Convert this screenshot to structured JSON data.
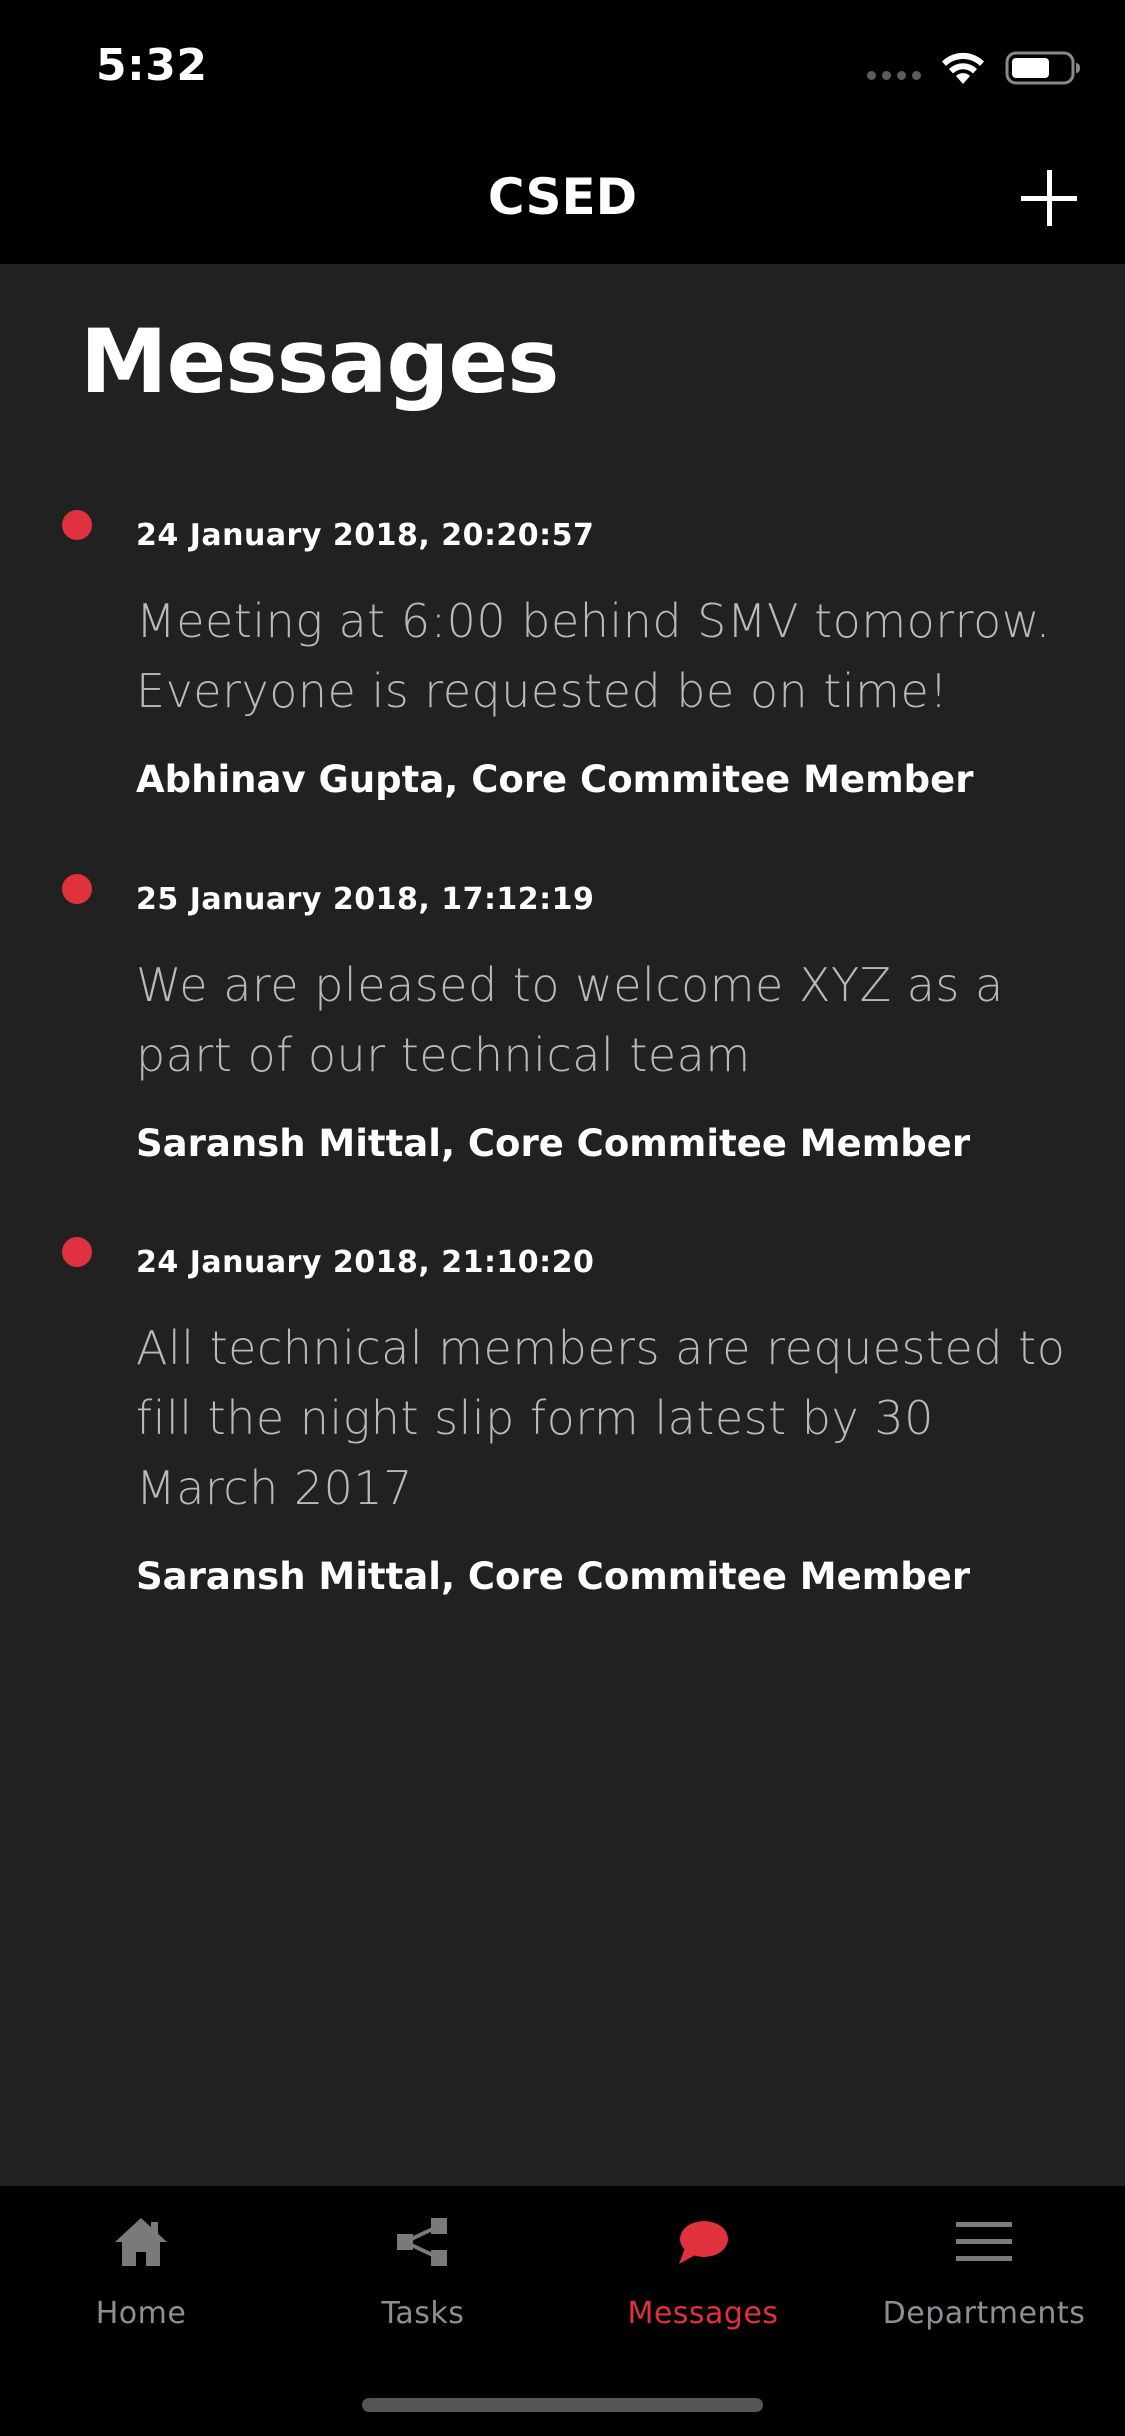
{
  "status_bar": {
    "time": "5:32",
    "icons": [
      "signal-dots",
      "wifi-icon",
      "battery-icon"
    ]
  },
  "nav": {
    "title": "CSED",
    "add_icon": "plus-icon"
  },
  "page": {
    "title": "Messages"
  },
  "colors": {
    "background": "#212121",
    "bar": "#000000",
    "accent": "#e0313f",
    "body_text": "#b9b9b9",
    "inactive_tab": "#8e8e93"
  },
  "messages": [
    {
      "date": "24 January 2018, 20:20:57",
      "body": "Meeting at 6:00 behind SMV tomorrow. Everyone is requested be on time!",
      "author": "Abhinav Gupta, Core Commitee Member"
    },
    {
      "date": "25 January 2018, 17:12:19",
      "body": "We are pleased to welcome XYZ as a part of our technical team",
      "author": "Saransh Mittal, Core Commitee Member"
    },
    {
      "date": "24 January 2018, 21:10:20",
      "body": "All technical members are requested to fill the night slip form latest by 30 March 2017",
      "author": "Saransh Mittal, Core Commitee Member"
    }
  ],
  "tabs": [
    {
      "label": "Home",
      "icon": "house-icon",
      "active": false
    },
    {
      "label": "Tasks",
      "icon": "share-nodes-icon",
      "active": false
    },
    {
      "label": "Messages",
      "icon": "speech-bubble-icon",
      "active": true
    },
    {
      "label": "Departments",
      "icon": "hamburger-icon",
      "active": false
    }
  ]
}
